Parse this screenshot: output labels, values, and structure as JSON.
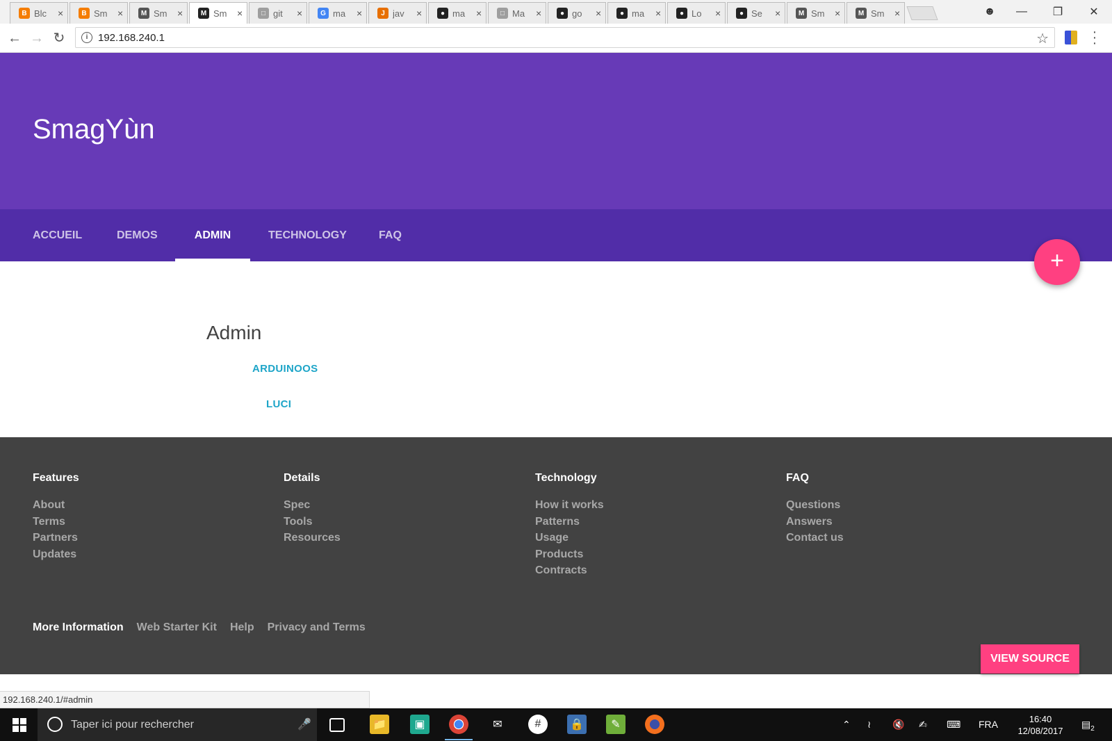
{
  "browser": {
    "tabs": [
      {
        "title": "Blc",
        "fav": "B",
        "color": "#f57d00"
      },
      {
        "title": "Sm",
        "fav": "B",
        "color": "#f57d00"
      },
      {
        "title": "Sm",
        "fav": "M",
        "color": "#555555"
      },
      {
        "title": "Sm",
        "fav": "M",
        "color": "#222222",
        "active": true
      },
      {
        "title": "git",
        "fav": "□",
        "color": "#9e9e9e"
      },
      {
        "title": "ma",
        "fav": "G",
        "color": "#4285f4"
      },
      {
        "title": "jav",
        "fav": "J",
        "color": "#e76f00"
      },
      {
        "title": "ma",
        "fav": "●",
        "color": "#222222"
      },
      {
        "title": "Ma",
        "fav": "□",
        "color": "#9e9e9e"
      },
      {
        "title": "go",
        "fav": "●",
        "color": "#222222"
      },
      {
        "title": "ma",
        "fav": "●",
        "color": "#222222"
      },
      {
        "title": "Lo",
        "fav": "●",
        "color": "#222222"
      },
      {
        "title": "Se",
        "fav": "●",
        "color": "#222222"
      },
      {
        "title": "Sm",
        "fav": "M",
        "color": "#555555"
      },
      {
        "title": "Sm",
        "fav": "M",
        "color": "#555555"
      }
    ],
    "close_glyph": "×",
    "url": "192.168.240.1",
    "status_url": "192.168.240.1/#admin"
  },
  "site": {
    "title": "SmagYùn",
    "nav": [
      {
        "label": "ACCUEIL",
        "active": false
      },
      {
        "label": "DEMOS",
        "active": false
      },
      {
        "label": "ADMIN",
        "active": true
      },
      {
        "label": "TECHNOLOGY",
        "active": false
      },
      {
        "label": "FAQ",
        "active": false
      }
    ],
    "fab_glyph": "+",
    "page_heading": "Admin",
    "admin_links": [
      "ARDUINOOS",
      "LUCI"
    ]
  },
  "footer": {
    "columns": [
      {
        "heading": "Features",
        "links": [
          "About",
          "Terms",
          "Partners",
          "Updates"
        ]
      },
      {
        "heading": "Details",
        "links": [
          "Spec",
          "Tools",
          "Resources"
        ]
      },
      {
        "heading": "Technology",
        "links": [
          "How it works",
          "Patterns",
          "Usage",
          "Products",
          "Contracts"
        ]
      },
      {
        "heading": "FAQ",
        "links": [
          "Questions",
          "Answers",
          "Contact us"
        ]
      }
    ],
    "more_info": {
      "lead": "More Information",
      "links": [
        "Web Starter Kit",
        "Help",
        "Privacy and Terms"
      ]
    },
    "view_source": "VIEW SOURCE"
  },
  "taskbar": {
    "search_placeholder": "Taper ici pour rechercher",
    "language": "FRA",
    "time": "16:40",
    "date": "12/08/2017",
    "notification_count": "2"
  },
  "colors": {
    "primary": "#673ab7",
    "primary_dark": "#512da8",
    "accent": "#ff4081",
    "link": "#1ea5c8",
    "footer": "#424242"
  }
}
